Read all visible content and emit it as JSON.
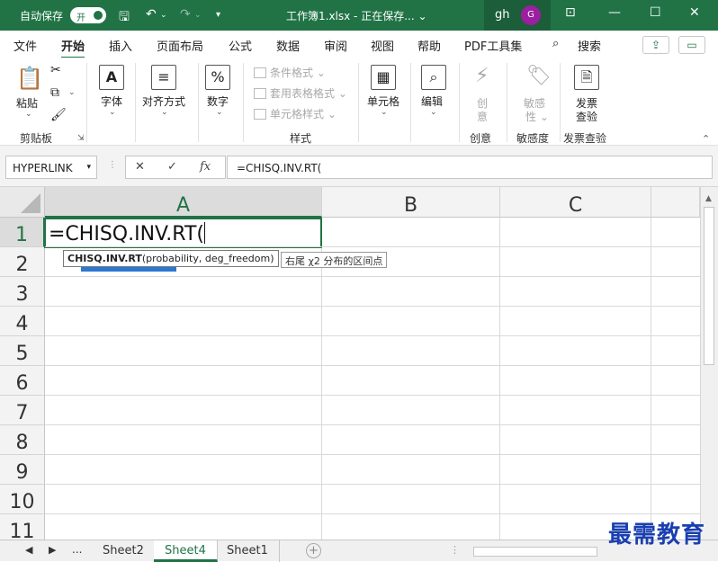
{
  "titlebar": {
    "autosave_label": "自动保存",
    "autosave_state": "开",
    "document_title": "工作簿1.xlsx - 正在保存... ⌄",
    "user_initials": "gh",
    "avatar_letter": "G",
    "avatar_color": "#9b1fa0"
  },
  "menu": {
    "items": [
      "文件",
      "开始",
      "插入",
      "页面布局",
      "公式",
      "数据",
      "审阅",
      "视图",
      "帮助",
      "PDF工具集"
    ],
    "active": "开始",
    "search_label": "搜索"
  },
  "ribbon": {
    "paste_label": "粘贴",
    "clipboard_group": "剪贴板",
    "font_label": "字体",
    "alignment_label": "对齐方式",
    "number_label": "数字",
    "conditional_format": "条件格式 ⌄",
    "table_format": "套用表格格式 ⌄",
    "cell_styles": "单元格样式 ⌄",
    "styles_group": "样式",
    "cells_label": "单元格",
    "editing_label": "编辑",
    "creative_top": "创",
    "creative_bottom": "意",
    "creative_group": "创意",
    "sensitivity_top": "敏感",
    "sensitivity_bottom": "性 ⌄",
    "sensitivity_group": "敏感度",
    "invoice_top": "发票",
    "invoice_bottom": "查验",
    "invoice_group": "发票查验"
  },
  "formula_bar": {
    "name_box": "HYPERLINK",
    "fx": "fx",
    "content": "=CHISQ.INV.RT("
  },
  "grid": {
    "columns": [
      "A",
      "B",
      "C"
    ],
    "rows": [
      "1",
      "2",
      "3",
      "4",
      "5",
      "6",
      "7",
      "8",
      "9",
      "10",
      "11"
    ],
    "active_cell_text": "=CHISQ.INV.RT(",
    "tooltip_func": "CHISQ.INV.RT",
    "tooltip_args": "(probability, deg_freedom)",
    "description_tip": "右尾 χ2 分布的区间点"
  },
  "sheets": {
    "ellipsis": "...",
    "tabs": [
      "Sheet2",
      "Sheet4",
      "Sheet1"
    ],
    "active": "Sheet4"
  },
  "watermark": "最需教育",
  "colors": {
    "accent": "#217346",
    "watermark": "#1a3fb0",
    "tooltip_bar": "#2b78d0"
  }
}
